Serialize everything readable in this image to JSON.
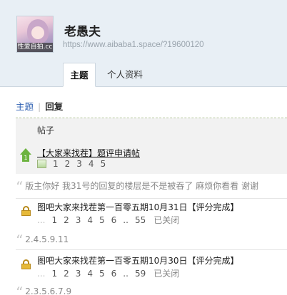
{
  "profile": {
    "avatar_caption": "性爱自拍.cc",
    "username": "老愚夫",
    "url": "https://www.aibaba1.space/?19600120"
  },
  "tabs": [
    {
      "label": "主题",
      "active": true
    },
    {
      "label": "个人资料",
      "active": false
    }
  ],
  "subnav": {
    "topics": "主题",
    "replies": "回复"
  },
  "thread_header": "帖子",
  "posts": [
    {
      "badge": "1",
      "title": "【大家来找茬】题评申请帖",
      "pages": [
        "1",
        "2",
        "3",
        "4",
        "5"
      ],
      "quote": "版主你好 我31号的回复的楼层是不是被吞了 麻烦你看看 谢谢"
    },
    {
      "title": "图吧大家来找茬第一百零五期10月31日【评分完成】",
      "pages_prefix": "...",
      "pages": [
        "1",
        "2",
        "3",
        "4",
        "5",
        "6",
        "..",
        "55"
      ],
      "status": "已关闭",
      "quote": "2.4.5.9.11"
    },
    {
      "title": "图吧大家来找茬第一百零五期10月30日【评分完成】",
      "pages_prefix": "...",
      "pages": [
        "1",
        "2",
        "3",
        "4",
        "5",
        "6",
        "..",
        "59"
      ],
      "status": "已关闭",
      "quote": "2.3.5.6.7.9"
    }
  ],
  "icons": {
    "avatar": "avatar-image",
    "upvote": "up-arrow-icon",
    "attachment": "image-attachment-icon",
    "lock": "lock-icon",
    "quote": "quote-mark-icon"
  },
  "colors": {
    "header_bg": "#e8eff5",
    "link_blue": "#2a5db0",
    "accent_green": "#6cb33f",
    "lock_gold": "#e6b938"
  }
}
